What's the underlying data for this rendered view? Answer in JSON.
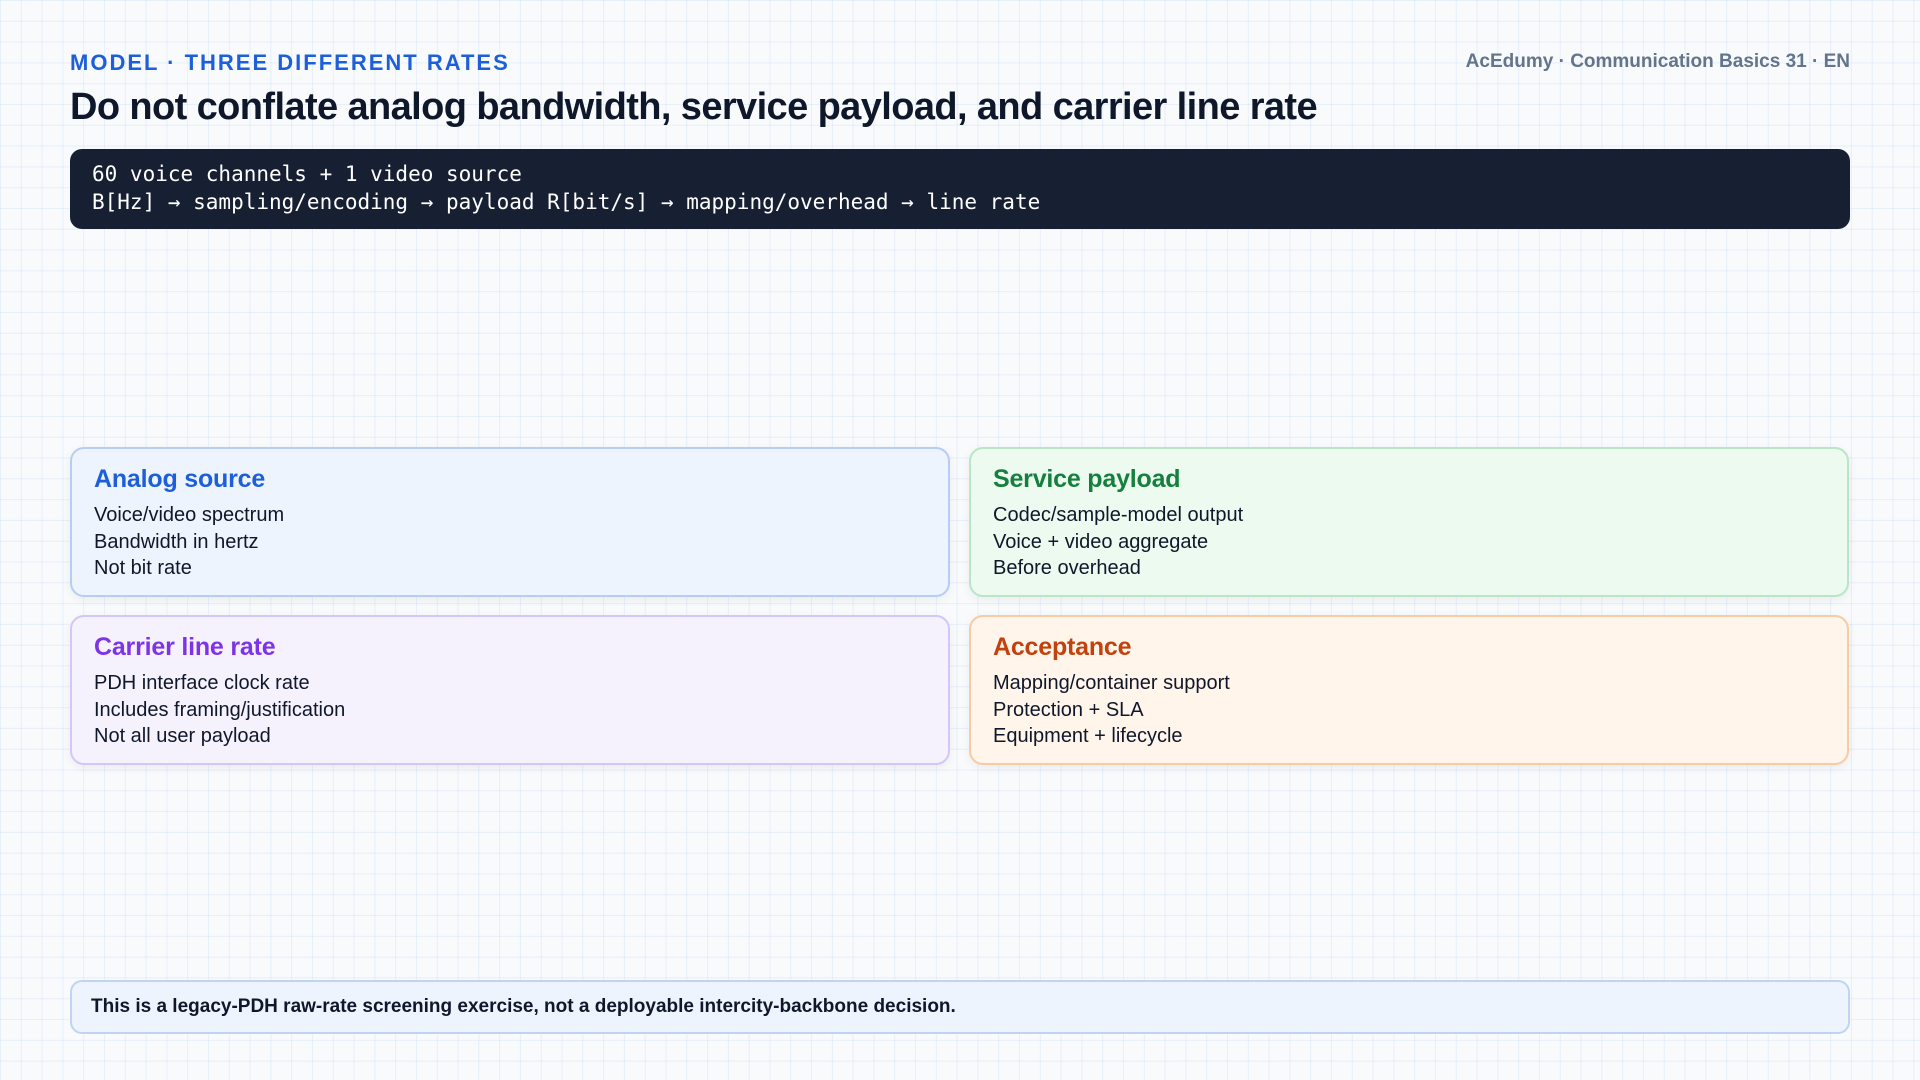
{
  "header": {
    "eyebrow": "MODEL · THREE DIFFERENT RATES",
    "brand": "AcEdumy · Communication Basics 31 · EN",
    "title": "Do not conflate analog bandwidth, service payload, and carrier line rate"
  },
  "formula": {
    "line1": "60 voice channels + 1 video source",
    "line2": "B[Hz] → sampling/encoding → payload R[bit/s] → mapping/overhead → line rate"
  },
  "cards": [
    {
      "title": "Analog source",
      "accent": "#1d5fd8",
      "lines": [
        "Voice/video spectrum",
        "Bandwidth in hertz",
        "Not bit rate"
      ]
    },
    {
      "title": "Service payload",
      "accent": "#15803d",
      "lines": [
        "Codec/sample-model output",
        "Voice + video aggregate",
        "Before overhead"
      ]
    },
    {
      "title": "Carrier line rate",
      "accent": "#7e34e6",
      "lines": [
        "PDH interface clock rate",
        "Includes framing/justification",
        "Not all user payload"
      ]
    },
    {
      "title": "Acceptance",
      "accent": "#c2410c",
      "lines": [
        "Mapping/container support",
        "Protection + SLA",
        "Equipment + lifecycle"
      ]
    }
  ],
  "footer": {
    "note": "This is a legacy-PDH raw-rate screening exercise, not a deployable intercity-backbone decision."
  }
}
